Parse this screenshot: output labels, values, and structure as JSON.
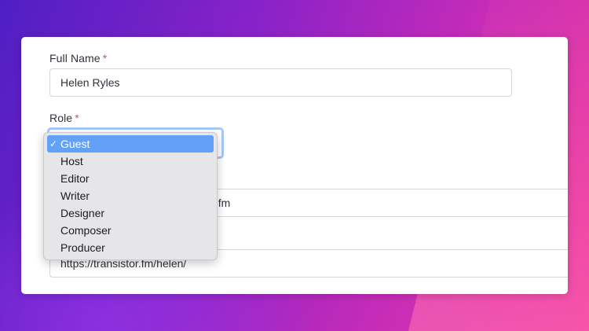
{
  "form": {
    "full_name": {
      "label": "Full Name",
      "required_mark": "*",
      "value": "Helen Ryles"
    },
    "role": {
      "label": "Role",
      "required_mark": "*",
      "selected": "Guest",
      "check_mark": "✓",
      "options": [
        "Guest",
        "Host",
        "Editor",
        "Writer",
        "Designer",
        "Composer",
        "Producer"
      ]
    },
    "email": {
      "value_visible_tail": "r.fm"
    },
    "website": {
      "value": "https://transistor.fm/helen/"
    }
  },
  "colors": {
    "selected_option_bg": "#63a1f7",
    "required_mark": "#e5484d",
    "focus_ring": "#a8c8f8"
  }
}
